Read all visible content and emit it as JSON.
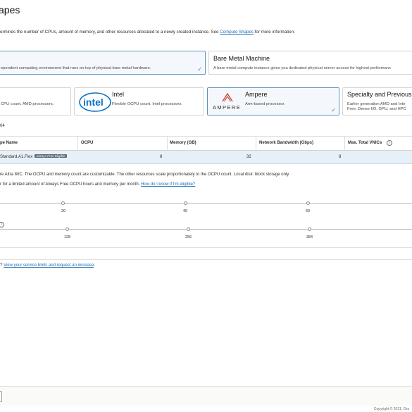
{
  "page": {
    "title": "apes",
    "subtitle_prefix": "ermines the number of CPUs, amount of memory, and other resources allocated to a newly created instance. See ",
    "subtitle_link": "Compute Shapes",
    "subtitle_suffix": " for more information."
  },
  "instance_type": {
    "vm": {
      "description": "ependent computing environment that runs on top of physical bare metal hardware."
    },
    "bm": {
      "title": "Bare Metal Machine",
      "description": "A bare metal compute instance gives you dedicated physical server access for highest performanc"
    }
  },
  "series": {
    "amd": {
      "description": "CPU count. AMD processors."
    },
    "intel": {
      "logo": "intel",
      "title": "Intel",
      "description": "Flexible OCPU count. Intel processors."
    },
    "ampere": {
      "logo": "AMPERE",
      "title": "Ampere",
      "description": "Arm-based processor."
    },
    "specialty": {
      "title": "Specialty and Previous",
      "description_line1": "Earlier generation AMD and Inte",
      "description_line2": "Free, Dense I/O, GPU, and HPC"
    }
  },
  "selection_count": "04",
  "table": {
    "headers": [
      "pe Name",
      "OCPU",
      "Memory (GB)",
      "Network Bandwidth (Gbps)",
      "Max. Total VNICs"
    ],
    "row": {
      "name": "Standard.A1.Flex",
      "badge": "Always Free Eligible",
      "ocpu": "8",
      "memory": "32",
      "bandwidth": "8"
    }
  },
  "details": {
    "line1": "re Altra 80C. The OCPU and memory count are customizable. The other resources scale proportionately to the OCPU count. Local disk: block storage only.",
    "line2_prefix": "r for a limited amount of Always Free OCPU hours and memory per month. ",
    "line2_link": "How do I know if I'm eligible?"
  },
  "ocpu_slider": {
    "ticks": [
      "20",
      "40",
      "60"
    ]
  },
  "memory_slider": {
    "ticks": [
      "128",
      "256",
      "384"
    ]
  },
  "limits": {
    "prefix": "? ",
    "link": "View your service limits and request an increase",
    "suffix": "."
  },
  "footer": {
    "copyright": "Copyright © 2021, Ora"
  },
  "colors": {
    "accent": "#1a6fb5",
    "selected_bg": "#e6f0f8",
    "badge": "#5b6b77",
    "check": "#3a7bbf"
  }
}
